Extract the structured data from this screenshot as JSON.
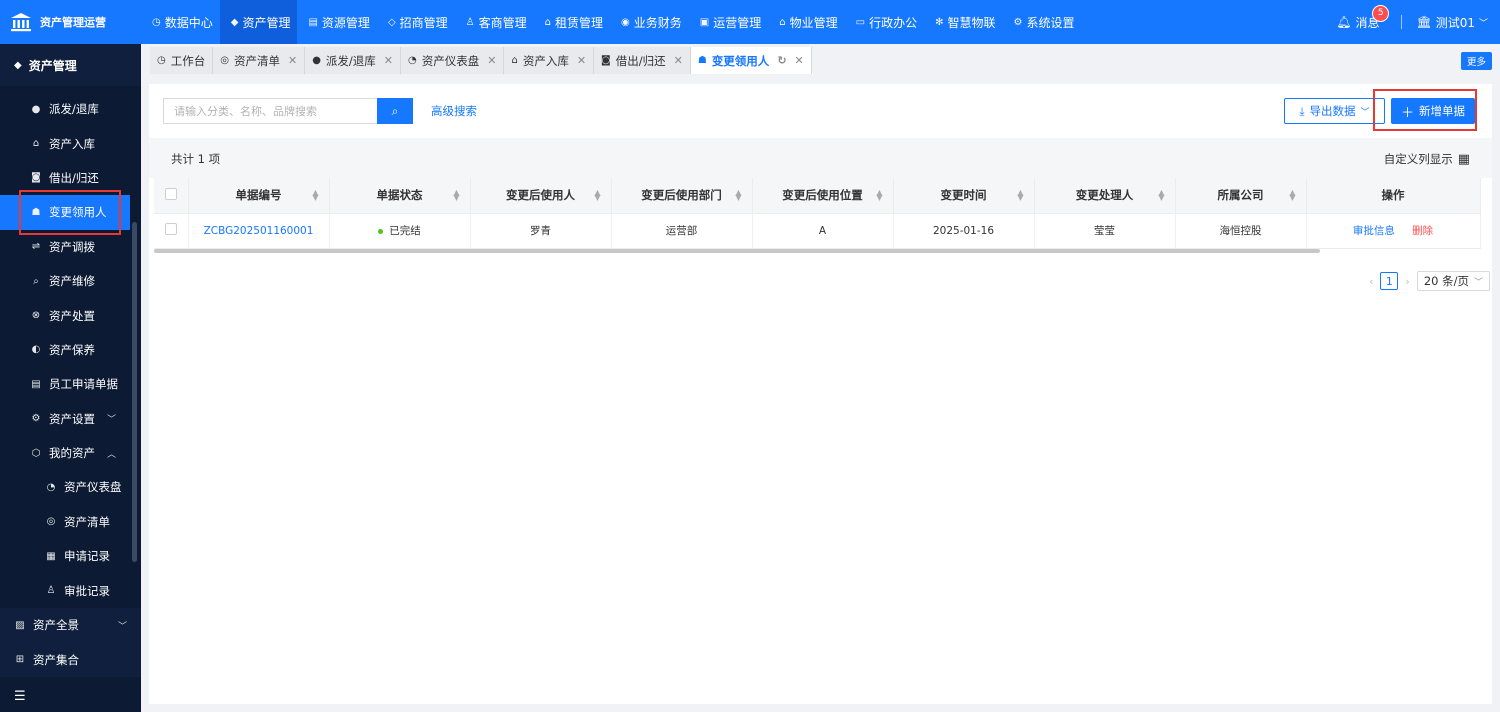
{
  "brand": {
    "title": "资产管理运营",
    "icon": "bank-icon"
  },
  "topnav": [
    {
      "label": "数据中心",
      "icon": "dashboard-icon",
      "active": false
    },
    {
      "label": "资产管理",
      "icon": "cube-icon",
      "active": true
    },
    {
      "label": "资源管理",
      "icon": "building-icon",
      "active": false
    },
    {
      "label": "招商管理",
      "icon": "tag-icon",
      "active": false
    },
    {
      "label": "客商管理",
      "icon": "users-icon",
      "active": false
    },
    {
      "label": "租赁管理",
      "icon": "home-icon",
      "active": false
    },
    {
      "label": "业务财务",
      "icon": "coin-icon",
      "active": false
    },
    {
      "label": "运营管理",
      "icon": "chart-icon",
      "active": false
    },
    {
      "label": "物业管理",
      "icon": "house-icon",
      "active": false
    },
    {
      "label": "行政办公",
      "icon": "monitor-icon",
      "active": false
    },
    {
      "label": "智慧物联",
      "icon": "iot-icon",
      "active": false
    },
    {
      "label": "系统设置",
      "icon": "gear-icon",
      "active": false
    }
  ],
  "topright": {
    "messages_label": "消息",
    "messages_count": "5",
    "user_label": "测试01"
  },
  "sidebar": {
    "header": "资产管理",
    "items": [
      {
        "label": "派发/退库",
        "icon": "dispatch-icon"
      },
      {
        "label": "资产入库",
        "icon": "inbound-icon"
      },
      {
        "label": "借出/归还",
        "icon": "borrow-icon"
      },
      {
        "label": "变更领用人",
        "icon": "user-icon",
        "active": true
      },
      {
        "label": "资产调拨",
        "icon": "transfer-icon"
      },
      {
        "label": "资产维修",
        "icon": "search-icon"
      },
      {
        "label": "资产处置",
        "icon": "dispose-icon"
      },
      {
        "label": "资产保养",
        "icon": "maintain-icon"
      },
      {
        "label": "员工申请单据",
        "icon": "form-icon"
      },
      {
        "label": "资产设置",
        "icon": "settings-icon",
        "arrow": "﹀"
      },
      {
        "label": "我的资产",
        "icon": "box-icon",
        "arrow": "︿"
      },
      {
        "label": "资产仪表盘",
        "icon": "gauge-icon",
        "sub": true
      },
      {
        "label": "资产清单",
        "icon": "list-icon",
        "sub": true
      },
      {
        "label": "申请记录",
        "icon": "record-icon",
        "sub": true
      },
      {
        "label": "审批记录",
        "icon": "approve-icon",
        "sub": true
      }
    ],
    "lower": [
      {
        "label": "资产全景",
        "icon": "panorama-icon",
        "arrow": "﹀"
      },
      {
        "label": "资产集合",
        "icon": "grid-icon"
      }
    ],
    "fold_icon": "menu-fold-icon"
  },
  "tabs": [
    {
      "label": "工作台",
      "icon": "workbench-icon",
      "closable": false
    },
    {
      "label": "资产清单",
      "icon": "list-icon",
      "closable": true
    },
    {
      "label": "派发/退库",
      "icon": "dispatch-icon",
      "closable": true
    },
    {
      "label": "资产仪表盘",
      "icon": "gauge-icon",
      "closable": true
    },
    {
      "label": "资产入库",
      "icon": "inbound-icon",
      "closable": true
    },
    {
      "label": "借出/归还",
      "icon": "borrow-icon",
      "closable": true
    },
    {
      "label": "变更领用人",
      "icon": "user-icon",
      "closable": true,
      "active": true
    }
  ],
  "more_label": "更多",
  "toolbar": {
    "search_placeholder": "请输入分类、名称、品牌搜索",
    "advanced_search": "高级搜索",
    "export_label": "导出数据",
    "new_label": "新增单据"
  },
  "summary": {
    "count_text": "共计 1 项",
    "custom_columns": "自定义列显示"
  },
  "table": {
    "columns": [
      "单据编号",
      "单据状态",
      "变更后使用人",
      "变更后使用部门",
      "变更后使用位置",
      "变更时间",
      "变更处理人",
      "所属公司",
      "操作"
    ],
    "rows": [
      {
        "doc_no": "ZCBG202501160001",
        "status": "已完结",
        "new_user": "罗青",
        "new_dept": "运营部",
        "new_location": "A",
        "change_time": "2025-01-16",
        "handler": "莹莹",
        "company": "海恒控股",
        "action_approve": "审批信息",
        "action_delete": "删除"
      }
    ]
  },
  "pagination": {
    "current_page": "1",
    "page_size": "20 条/页"
  },
  "colors": {
    "primary": "#1677ff",
    "sidebar_bg": "#0c1a33",
    "danger": "#ff4d4f",
    "success": "#52c41a",
    "highlight": "#e53935"
  }
}
